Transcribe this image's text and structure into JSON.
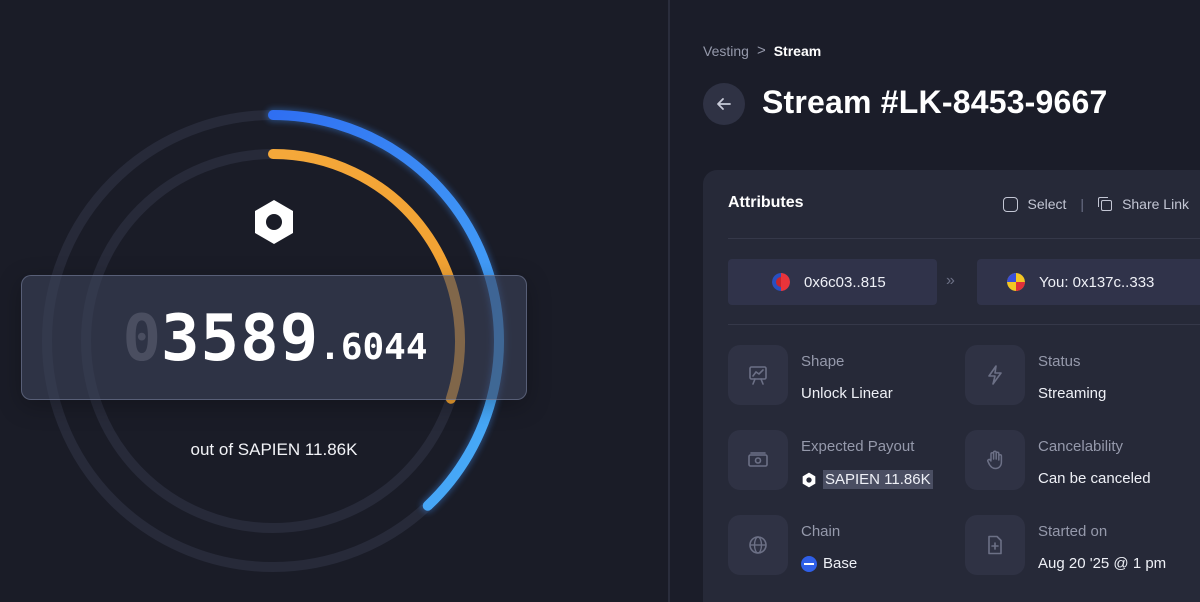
{
  "stream_display": {
    "counter_leading": "0",
    "counter_integer": "3589",
    "counter_decimal": ".6044",
    "out_of_text": "out of SAPIEN 11.86K",
    "streamed_fraction": 0.3,
    "expected_fraction": 0.38
  },
  "breadcrumb": {
    "parent": "Vesting",
    "separator": ">",
    "current": "Stream"
  },
  "page_title": "Stream #LK-8453-9667",
  "attributes_card": {
    "heading": "Attributes",
    "select_label": "Select",
    "divider": "|",
    "share_label": "Share Link",
    "sender": "0x6c03..815",
    "arrow": "»",
    "recipient": "You: 0x137c..333",
    "items": [
      {
        "label": "Shape",
        "value": "Unlock Linear",
        "icon": "chart-board-icon"
      },
      {
        "label": "Status",
        "value": "Streaming",
        "icon": "lightning-icon"
      },
      {
        "label": "Expected Payout",
        "value": "SAPIEN 11.86K",
        "icon": "money-icon"
      },
      {
        "label": "Cancelability",
        "value": "Can be canceled",
        "icon": "hand-icon"
      },
      {
        "label": "Chain",
        "value": "Base",
        "icon": "globe-icon"
      },
      {
        "label": "Started on",
        "value": "Aug 20 '25 @ 1 pm",
        "icon": "file-plus-icon"
      }
    ]
  },
  "colors": {
    "accent_blue": "#3d8ef5",
    "accent_orange": "#f5a83a",
    "background": "#1a1c27",
    "card": "#262938"
  }
}
